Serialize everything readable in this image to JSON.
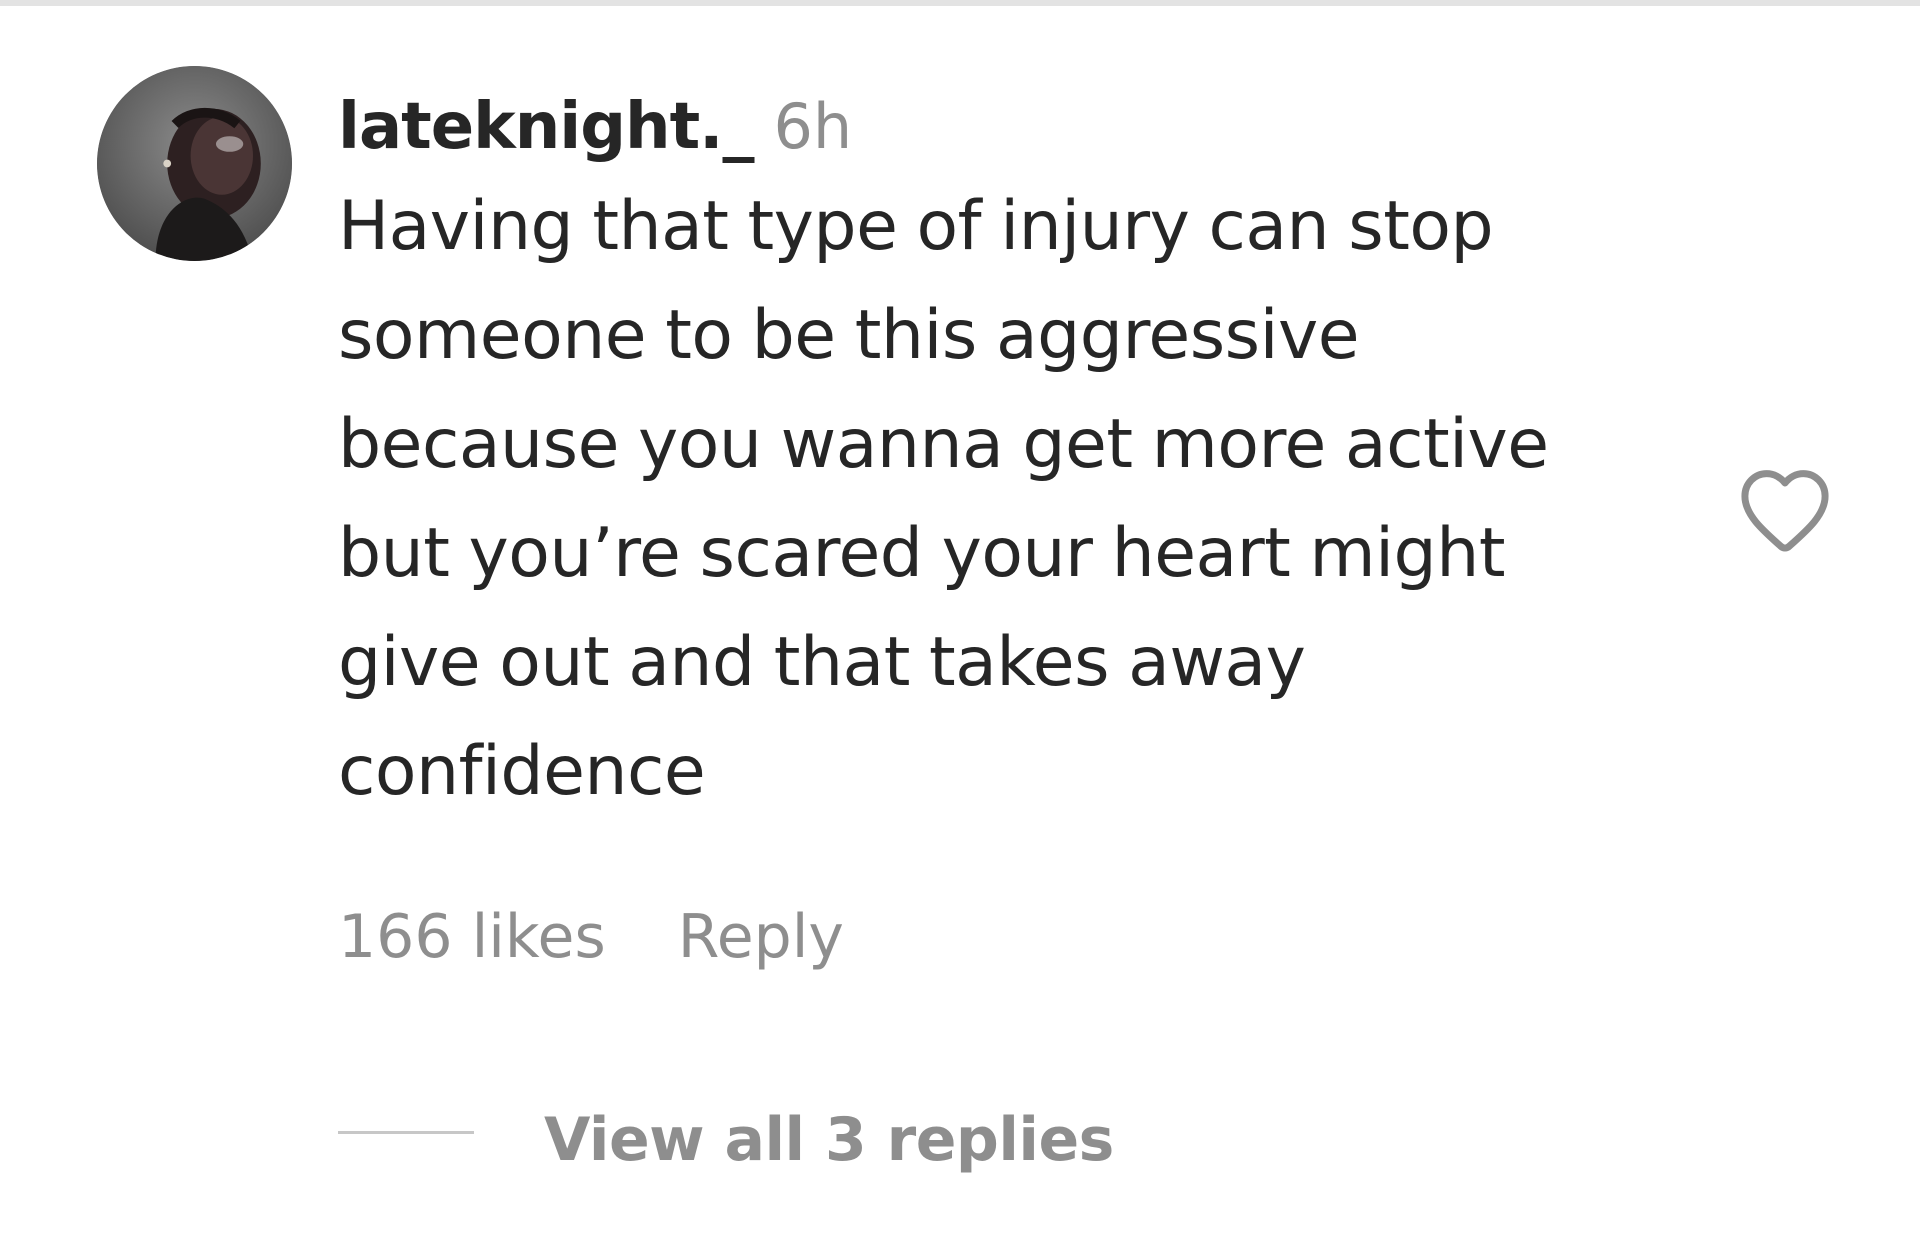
{
  "comment": {
    "username": "lateknight._",
    "time": "6h",
    "text_lines": [
      "Having that type of injury can stop",
      "someone to be this aggressive",
      "because you wanna get more active",
      "but you’re scared your heart might",
      "give out and that takes away",
      "confidence"
    ],
    "likes": "166 likes",
    "reply_label": "Reply",
    "view_replies_label": "View all 3 replies",
    "like_icon": "heart-outline-icon",
    "avatar_icon": "user-avatar-photo"
  },
  "colors": {
    "primary_text": "#262626",
    "secondary_text": "#8e8e8e",
    "divider": "#e3e3e3"
  }
}
